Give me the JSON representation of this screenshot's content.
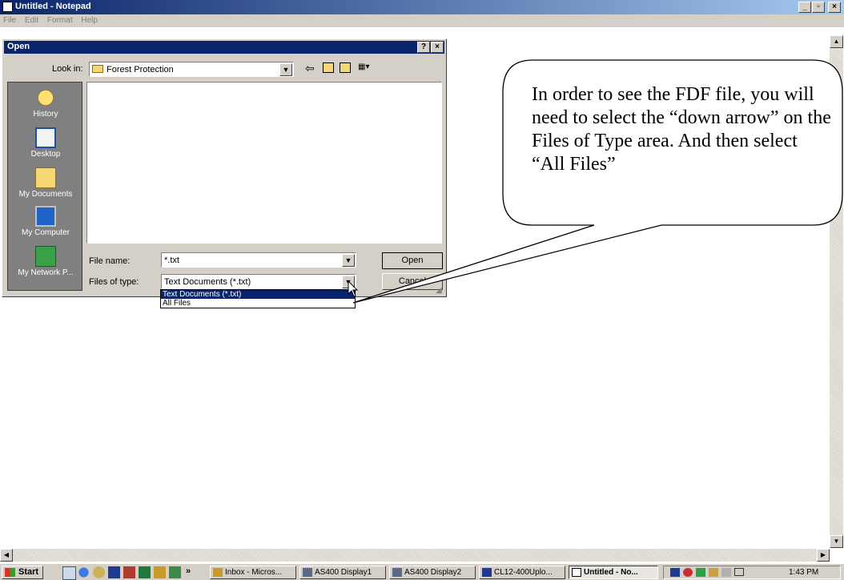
{
  "notepad": {
    "title": "Untitled - Notepad",
    "menu": [
      "File",
      "Edit",
      "Format",
      "Help"
    ],
    "controls": {
      "minimize": "_",
      "maximize": "▫",
      "close": "×"
    }
  },
  "dialog": {
    "title": "Open",
    "help": "?",
    "close": "×",
    "look_in_label": "Look in:",
    "look_in_value": "Forest Protection",
    "places": [
      "History",
      "Desktop",
      "My Documents",
      "My Computer",
      "My Network P..."
    ],
    "file_name_label": "File name:",
    "file_name_value": "*.txt",
    "files_of_type_label": "Files of type:",
    "files_of_type_value": "Text Documents (*.txt)",
    "open_button": "Open",
    "cancel_button": "Cancel",
    "dropdown_options": [
      "Text Documents (*.txt)",
      "All Files"
    ]
  },
  "callout": {
    "text": "In order to see the FDF file, you will need to select the “down arrow” on the Files of Type area.  And then select “All Files”"
  },
  "taskbar": {
    "start": "Start",
    "chevron": "»",
    "buttons": [
      "Inbox - Micros...",
      "AS400 Display1",
      "AS400 Display2",
      "CL12-400Uplo...",
      "Untitled - No..."
    ],
    "clock": "1:43 PM"
  }
}
